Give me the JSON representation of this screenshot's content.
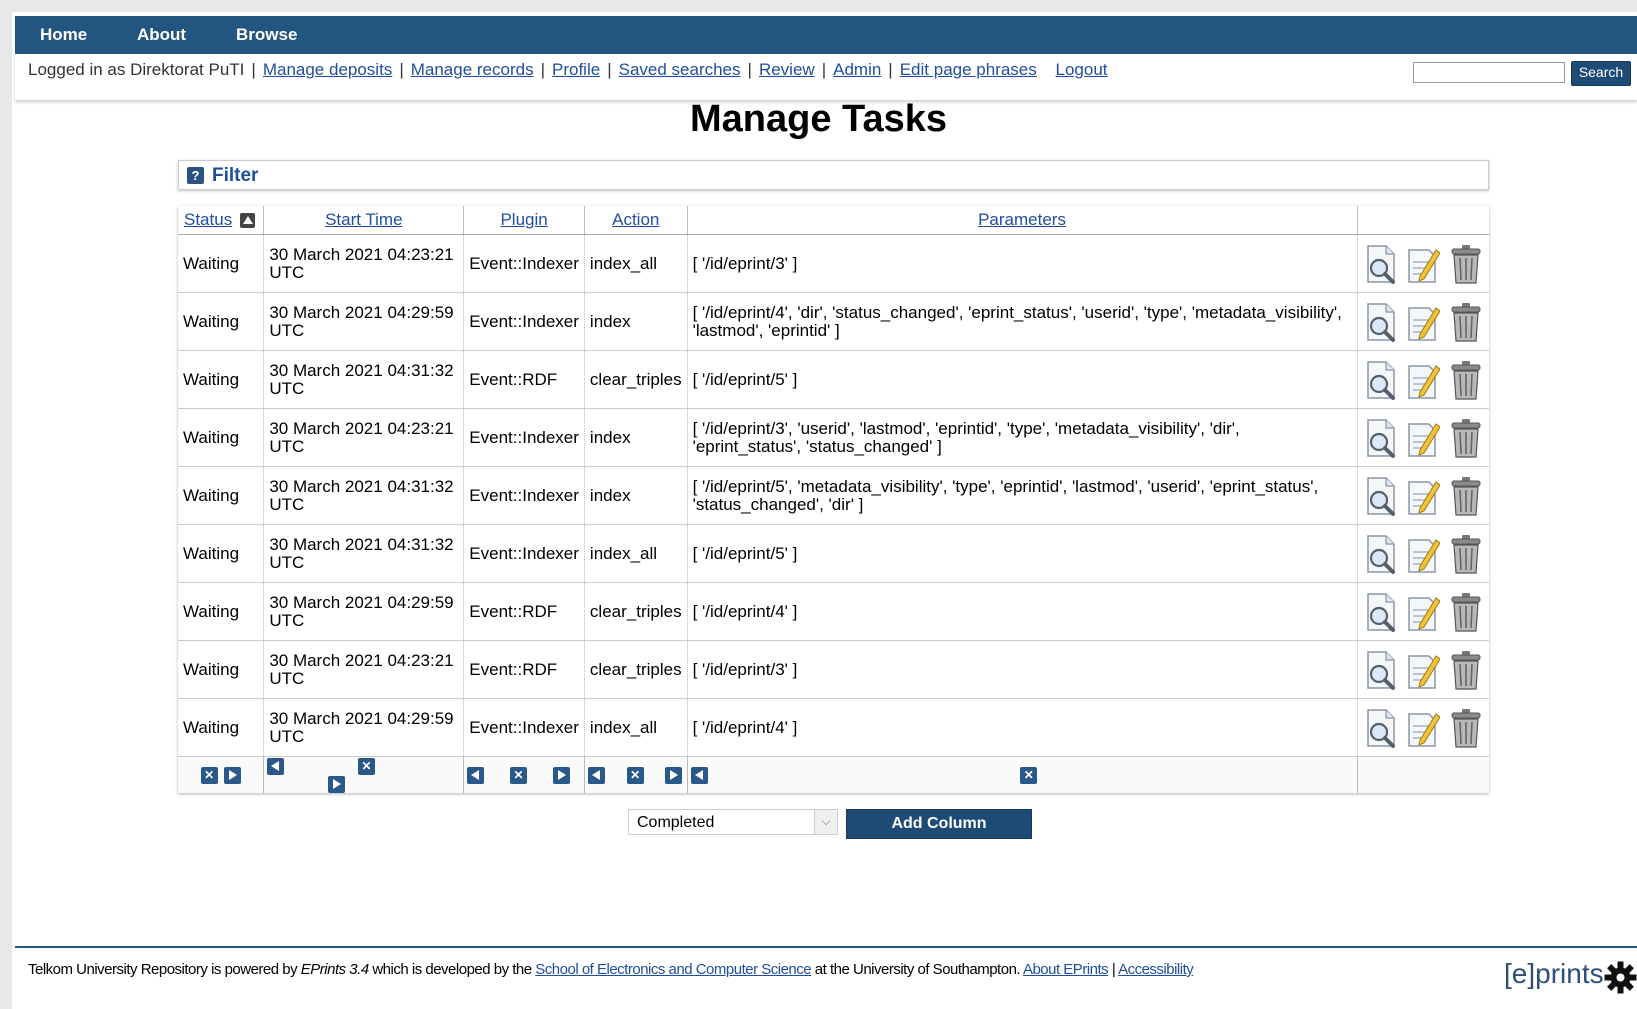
{
  "nav": {
    "items": [
      "Home",
      "About",
      "Browse"
    ]
  },
  "keytools": {
    "logged_in_text": "Logged in as Direktorat PuTI",
    "links": [
      "Manage deposits",
      "Manage records",
      "Profile",
      "Saved searches",
      "Review",
      "Admin",
      "Edit page phrases"
    ],
    "logout": "Logout",
    "search_value": "",
    "search_button": "Search"
  },
  "page_title": "Manage Tasks",
  "filter_label": "Filter",
  "filter_icon": "?",
  "table": {
    "headers": [
      "Status",
      "Start Time",
      "Plugin",
      "Action",
      "Parameters"
    ],
    "rows": [
      {
        "status": "Waiting",
        "start": "30 March 2021 04:23:21",
        "tz": "UTC",
        "plugin": "Event::Indexer",
        "action": "index_all",
        "params": "[ '/id/eprint/3' ]"
      },
      {
        "status": "Waiting",
        "start": "30 March 2021 04:29:59",
        "tz": "UTC",
        "plugin": "Event::Indexer",
        "action": "index",
        "params": "[ '/id/eprint/4', 'dir', 'status_changed', 'eprint_status', 'userid', 'type', 'metadata_visibility', 'lastmod', 'eprintid' ]"
      },
      {
        "status": "Waiting",
        "start": "30 March 2021 04:31:32",
        "tz": "UTC",
        "plugin": "Event::RDF",
        "action": "clear_triples",
        "params": "[ '/id/eprint/5' ]"
      },
      {
        "status": "Waiting",
        "start": "30 March 2021 04:23:21",
        "tz": "UTC",
        "plugin": "Event::Indexer",
        "action": "index",
        "params": "[ '/id/eprint/3', 'userid', 'lastmod', 'eprintid', 'type', 'metadata_visibility', 'dir', 'eprint_status', 'status_changed' ]"
      },
      {
        "status": "Waiting",
        "start": "30 March 2021 04:31:32",
        "tz": "UTC",
        "plugin": "Event::Indexer",
        "action": "index",
        "params": "[ '/id/eprint/5', 'metadata_visibility', 'type', 'eprintid', 'lastmod', 'userid', 'eprint_status', 'status_changed', 'dir' ]"
      },
      {
        "status": "Waiting",
        "start": "30 March 2021 04:31:32",
        "tz": "UTC",
        "plugin": "Event::Indexer",
        "action": "index_all",
        "params": "[ '/id/eprint/5' ]"
      },
      {
        "status": "Waiting",
        "start": "30 March 2021 04:29:59",
        "tz": "UTC",
        "plugin": "Event::RDF",
        "action": "clear_triples",
        "params": "[ '/id/eprint/4' ]"
      },
      {
        "status": "Waiting",
        "start": "30 March 2021 04:23:21",
        "tz": "UTC",
        "plugin": "Event::RDF",
        "action": "clear_triples",
        "params": "[ '/id/eprint/3' ]"
      },
      {
        "status": "Waiting",
        "start": "30 March 2021 04:29:59",
        "tz": "UTC",
        "plugin": "Event::Indexer",
        "action": "index_all",
        "params": "[ '/id/eprint/4' ]"
      }
    ]
  },
  "add_column": {
    "selected": "Completed",
    "button": "Add Column"
  },
  "footer": {
    "repo": "Telkom University Repository",
    "powered_by": "is powered by",
    "eprints_version": "EPrints 3.4",
    "developed_by": "which is developed by the",
    "school_link": "School of Electronics and Computer Science",
    "at_uni": "at the University of Southampton.",
    "about_link": "About EPrints",
    "pipe": "|",
    "accessibility_link": "Accessibility",
    "logo_left": "[e",
    "logo_right": "]prints"
  },
  "colors": {
    "nav_bg": "#22557f",
    "link": "#1f4e9e",
    "button_bg": "#1e4a76"
  }
}
